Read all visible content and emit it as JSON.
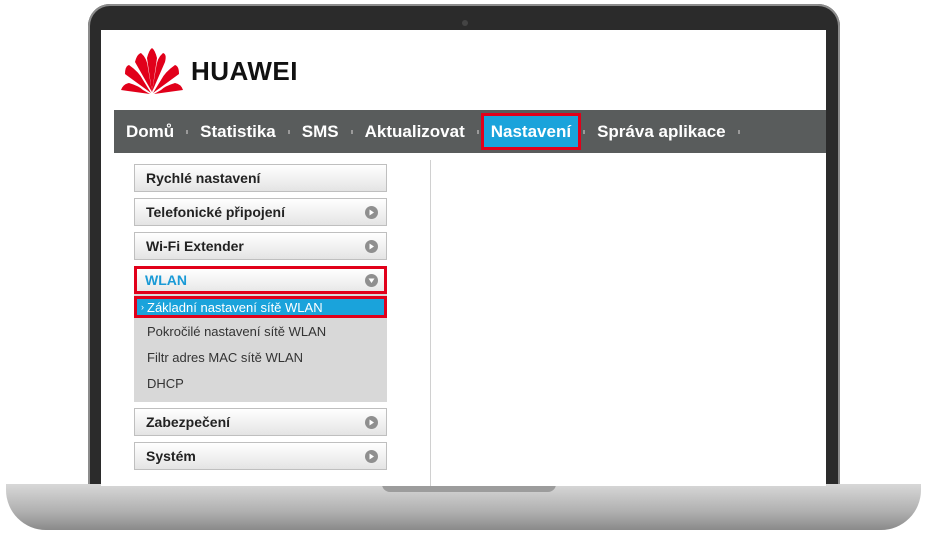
{
  "brand": {
    "name": "HUAWEI",
    "logo_color": "#e1001a"
  },
  "nav": {
    "items": [
      {
        "label": "Domů",
        "active": false
      },
      {
        "label": "Statistika",
        "active": false
      },
      {
        "label": "SMS",
        "active": false
      },
      {
        "label": "Aktualizovat",
        "active": false
      },
      {
        "label": "Nastavení",
        "active": true
      },
      {
        "label": "Správa aplikace",
        "active": false
      }
    ],
    "active_color": "#1aa3db",
    "highlight_color": "#e1001a"
  },
  "sidebar": {
    "quick": "Rychlé nastavení",
    "phone": "Telefonické připojení",
    "wifi_ext": "Wi-Fi Extender",
    "wlan": {
      "label": "WLAN",
      "sub": [
        {
          "label": "Základní nastavení sítě WLAN",
          "active": true
        },
        {
          "label": "Pokročilé nastavení sítě WLAN",
          "active": false
        },
        {
          "label": "Filtr adres MAC sítě WLAN",
          "active": false
        },
        {
          "label": "DHCP",
          "active": false
        }
      ]
    },
    "security": "Zabezpečení",
    "system": "Systém"
  }
}
